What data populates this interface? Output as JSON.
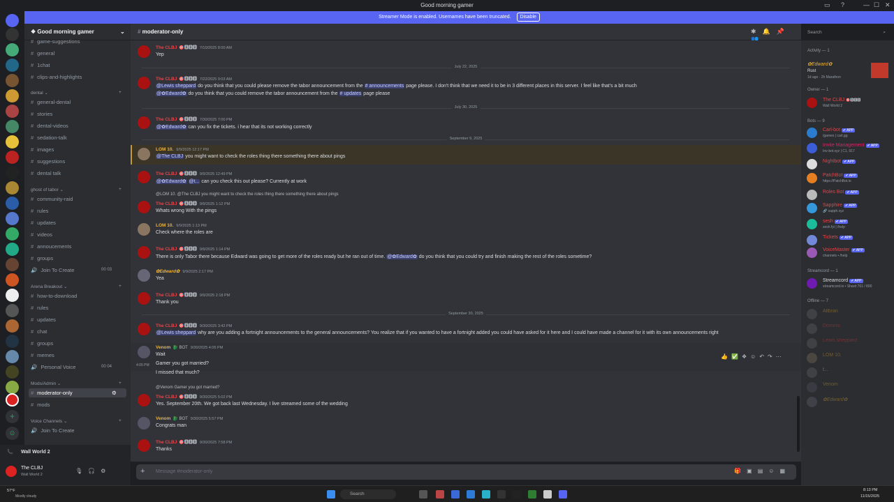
{
  "window": {
    "title": "Good morning gamer"
  },
  "banner": {
    "text": "Streamer Mode is enabled. Usernames have been truncated.",
    "button": "Disable"
  },
  "server": {
    "name": "Good morning gamer"
  },
  "channels": {
    "top": [
      "game-suggestions",
      "general",
      "1chat",
      "clips-and-highlights"
    ],
    "dental_cat": "dental",
    "dental": [
      "general-dental",
      "stories",
      "dental-videos",
      "sedation-talk",
      "images",
      "suggestions",
      "dental talk"
    ],
    "ghost_cat": "ghost of tabor",
    "ghost": [
      "community-raid",
      "rules",
      "updates",
      "videos",
      "annoucements",
      "groups"
    ],
    "ghost_voice": "Join To Create",
    "ghost_voice_badges": "00  03",
    "arena_cat": "Arena Breakout",
    "arena": [
      "how-to-download",
      "rules",
      "updates",
      "chat",
      "groups",
      "memes"
    ],
    "arena_voice": "Personal Voice",
    "arena_voice_badges": "00  04",
    "mods_cat": "Mods/Admin",
    "mods_active": "moderator-only",
    "mods": [
      "mods"
    ],
    "voice_cat": "Voice Channels",
    "voice": "Join To Create"
  },
  "user_panel": {
    "voice_server": "Wall World 2",
    "username": "The CLBJ",
    "status": "Wall World 2"
  },
  "header": {
    "channel": "moderator-only",
    "search_placeholder": "Search"
  },
  "dates": {
    "d1": "July 22, 2025",
    "d2": "July 30, 2025",
    "d3": "September 9, 2025",
    "d4": "September 30, 2025"
  },
  "messages": [
    {
      "author": "The CLBJ",
      "tags": "🎯🅱🅱🅱",
      "time": "7/10/2025 8:00 AM",
      "text": "Yep"
    },
    {
      "author": "The CLBJ",
      "tags": "🎯🅱🅱🅱",
      "time": "7/22/2025 9:03 AM",
      "mention": "@Lewis sheppard",
      "text": "do you think that you could please remove the tabor announcement from the",
      "channel": "# announcements",
      "text2": "page please. I don't think that we need it to be in 3 different places in this server. I feel like that's a bit much"
    },
    {
      "mention": "@✿Edward✿",
      "text": "do you think that you could remove the tabor announcement from the",
      "channel": "# updates",
      "text2": "page please"
    },
    {
      "author": "The CLBJ",
      "tags": "🎯🅱🅱🅱",
      "time": "7/30/2025 7:00 PM",
      "mention": "@✿Edward✿",
      "text": "can you fix the tickets. i hear that its not working correctly"
    },
    {
      "author": "LOM 10.",
      "time": "9/9/2025 12:17 PM",
      "mention": "@The CLBJ",
      "text": "you might want to check the roles thing there something there about pings"
    },
    {
      "author": "The CLBJ",
      "tags": "🎯🅱🅱🅱",
      "time": "9/9/2025 12:49 PM",
      "mention": "@✿Edward✿",
      "mention2": "@t...",
      "text": "can you check this out please? Currently at work"
    },
    {
      "reply": "@LOM 10.  @The CLBJ you might want to check the roles thing there something there about pings"
    },
    {
      "author": "The CLBJ",
      "tags": "🎯🅱🅱🅱",
      "time": "9/9/2025 1:12 PM",
      "text": "Whats wrong With the pings"
    },
    {
      "author": "LOM 10.",
      "time": "9/9/2025 1:13 PM",
      "text": "Check where the roles are"
    },
    {
      "author": "The CLBJ",
      "tags": "🎯🅱🅱🅱",
      "time": "9/9/2025 1:14 PM",
      "text": "There is only Tabor there because Edward was going to get more of the roles ready but he ran out of time.",
      "mention": "@✿Edward✿",
      "text2": "do you think that you could try and finish making the rest of the roles sometime?"
    },
    {
      "author": "✿Edward✿",
      "time": "9/9/2025 2:17 PM",
      "text": "Yea"
    },
    {
      "author": "The CLBJ",
      "tags": "🎯🅱🅱🅱",
      "time": "9/9/2025 2:18 PM",
      "text": "Thank you"
    },
    {
      "author": "The CLBJ",
      "tags": "🎯🅱🅱🅱",
      "time": "9/30/2025 3:42 PM",
      "mention": "@Lewis sheppard",
      "text": "why are you adding a fortnight announcements to the general announcements? You realize that if you wanted to have a fortnight added you could have asked for it here and I could have made a channel for it with its own announcements right"
    },
    {
      "author": "Venom",
      "tags": "🐉 BOT",
      "time": "9/30/2025 4:05 PM",
      "text": "Wait"
    },
    {
      "hover_time": "4:05 PM",
      "text": "Gamer you got married?"
    },
    {
      "text": "I missed that much?"
    },
    {
      "reply": "@Venom  Gamer you got married?"
    },
    {
      "author": "The CLBJ",
      "tags": "🎯🅱🅱🅱",
      "time": "9/30/2025 5:02 PM",
      "text": "Yes. September 20th. We got back last Wednesday. I live streamed some of the wedding"
    },
    {
      "author": "Venom",
      "tags": "🐉 BOT",
      "time": "9/30/2025 5:57 PM",
      "text": "Congrats man"
    },
    {
      "author": "The CLBJ",
      "tags": "🎯🅱🅱🅱",
      "time": "9/30/2025 7:58 PM",
      "text": "Thanks"
    }
  ],
  "input": {
    "placeholder": "Message #moderator-only"
  },
  "members": {
    "activity_head": "Activity — 1",
    "activity_name": "✿Edward✿",
    "activity_game": "Rust",
    "activity_time": "1d ago  ·  2h Marathon",
    "owner_head": "Owner — 1",
    "owner_name": "The CLBJ",
    "owner_tags": "🎯🅱🅱🅱",
    "owner_sub": "Wall World 2",
    "bots_head": "Bots — 9",
    "bots": [
      {
        "name": "Carl-bot",
        "sub": "/games | carl.gg",
        "color": "#f23f43"
      },
      {
        "name": "Invite Management",
        "sub": "Inv-bot.xyz | C1, 917",
        "color": "#e91e63"
      },
      {
        "name": "Nightbot",
        "sub": "",
        "color": "#f23f43"
      },
      {
        "name": "PatchBot",
        "sub": "https://PatchBot.io",
        "color": "#f23f43"
      },
      {
        "name": "Roles Bot",
        "sub": "",
        "color": "#f23f43"
      },
      {
        "name": "Sapphire",
        "sub": "🔗 sapph.xyz",
        "color": "#f23f43"
      },
      {
        "name": "sesh",
        "sub": "sesh.fyi | /help",
        "color": "#f23f43"
      },
      {
        "name": "Tickets",
        "sub": "",
        "color": "#f23f43"
      },
      {
        "name": "VoiceMaster",
        "sub": "channels • /help",
        "color": "#f23f43"
      }
    ],
    "app_label": "✔ APP",
    "streamcord_head": "Streamcord — 1",
    "streamcord": {
      "name": "Streamcord",
      "sub": "streamcord.io • Shard 761 / 800"
    },
    "offline_head": "Offline — 7",
    "offline": [
      "Allbran",
      "Dominic",
      "Lewis sheppard",
      "LOM 10.",
      "t...",
      "Venom",
      "✿Edward✿"
    ]
  },
  "taskbar": {
    "search": "Search",
    "time": "8:13 PM",
    "date": "11/15/2025",
    "weather": "Mostly cloudy",
    "temp": "57°F"
  },
  "colors": {
    "crimson": "#f23f43",
    "gold": "#f0b232",
    "blurple": "#5865f2",
    "venom": "#43b581"
  }
}
